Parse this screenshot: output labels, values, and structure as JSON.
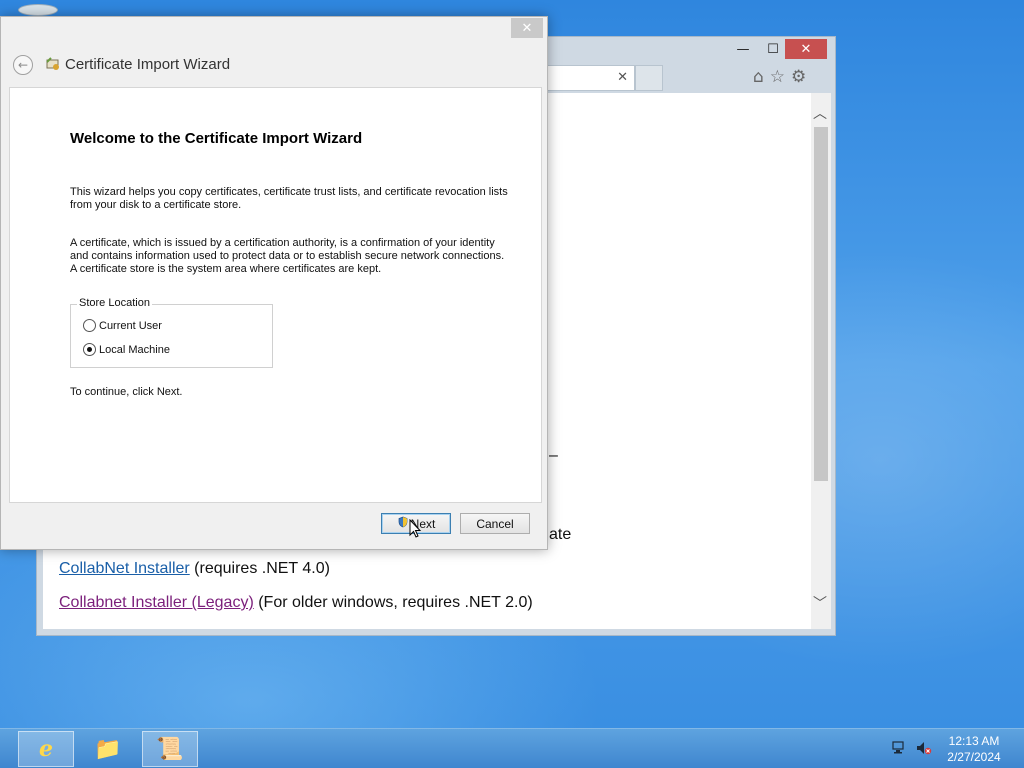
{
  "ie": {
    "tab_close": "✕",
    "controls": {
      "minimize": "—",
      "maximize": "☐",
      "close": "✕"
    },
    "toolbar_icons": {
      "home": "⌂",
      "favorites": "☆",
      "tools": "⚙"
    },
    "scroll_up": "︿",
    "scroll_down": "﹀",
    "page": {
      "fragment_dash": "–",
      "fragment_ate": "ate",
      "links": [
        {
          "text": "CollabNet Installer",
          "suffix": " (requires .NET 4.0)"
        },
        {
          "text": "Collabnet Installer (Legacy)",
          "suffix": " (For older windows, requires .NET 2.0)"
        }
      ]
    }
  },
  "wizard": {
    "close": "✕",
    "back": "←",
    "title": "Certificate Import Wizard",
    "heading": "Welcome to the Certificate Import Wizard",
    "para1": "This wizard helps you copy certificates, certificate trust lists, and certificate revocation lists from your disk to a certificate store.",
    "para2": "A certificate, which is issued by a certification authority, is a confirmation of your identity and contains information used to protect data or to establish secure network connections. A certificate store is the system area where certificates are kept.",
    "store_location": {
      "legend": "Store Location",
      "options": [
        {
          "label": "Current User",
          "checked": false
        },
        {
          "label": "Local Machine",
          "checked": true
        }
      ]
    },
    "continue_text": "To continue, click Next.",
    "buttons": {
      "next": "Next",
      "cancel": "Cancel"
    }
  },
  "taskbar": {
    "ie_glyph": "e",
    "folder_glyph": "📁",
    "cert_glyph": "📜",
    "clock_time": "12:13 AM",
    "clock_date": "2/27/2024"
  }
}
